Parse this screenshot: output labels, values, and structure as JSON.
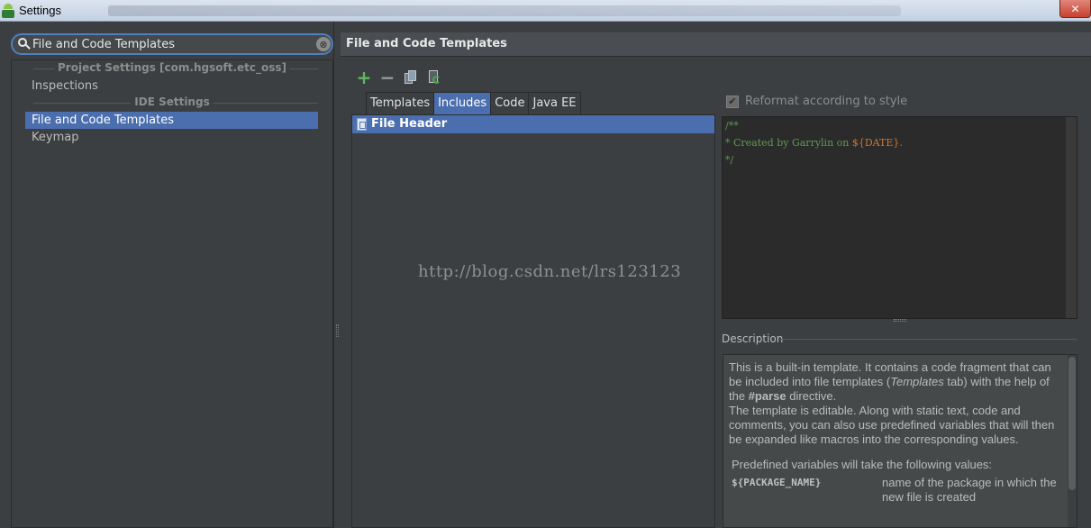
{
  "window": {
    "title": "Settings",
    "close_glyph": "✕"
  },
  "search": {
    "value": "File and Code Templates",
    "clear_glyph": "⊗"
  },
  "tree": {
    "project_section": "Project Settings [com.hgsoft.etc_oss]",
    "inspections": "Inspections",
    "ide_section": "IDE Settings",
    "file_and_code_templates": "File and Code Templates",
    "keymap": "Keymap"
  },
  "panel": {
    "header": "File and Code Templates",
    "toolbar": {
      "add": "+",
      "remove": "−"
    },
    "tabs": [
      "Templates",
      "Includes",
      "Code",
      "Java EE"
    ],
    "active_tab": "Includes",
    "list_items": [
      "File Header"
    ],
    "reformat_label": "Reformat according to style",
    "reformat_checked": "✔",
    "editor": {
      "line1": "/**",
      "line2_prefix": " * Created by Garrylin on ",
      "line2_var": "${DATE}",
      "line2_suffix": ".",
      "line3": " */"
    },
    "description_label": "Description",
    "description": {
      "p1_a": "This is a built-in template. It contains a code fragment that can be included into file templates (",
      "p1_italic": "Templates",
      "p1_b": " tab) with the help of the ",
      "p1_bold": "#parse",
      "p1_c": " directive.",
      "p2": "The template is editable. Along with static text, code and comments, you can also use predefined variables that will then be expanded like macros into the corresponding values.",
      "p3": "Predefined variables will take the following values:",
      "var_name": "${PACKAGE_NAME}",
      "var_desc": "name of the package in which the new file is created"
    }
  },
  "watermark": "http://blog.csdn.net/lrs123123",
  "colors": {
    "selection": "#4b6eaf",
    "background": "#3c3f41",
    "editor_bg": "#2b2b2b",
    "comment_green": "#629755",
    "var_orange": "#cc7832"
  },
  "icons": [
    "app-icon",
    "search-icon",
    "clear-icon",
    "close-icon",
    "add-icon",
    "remove-icon",
    "copy-icon",
    "reset-icon",
    "file-icon",
    "checkbox-icon"
  ]
}
